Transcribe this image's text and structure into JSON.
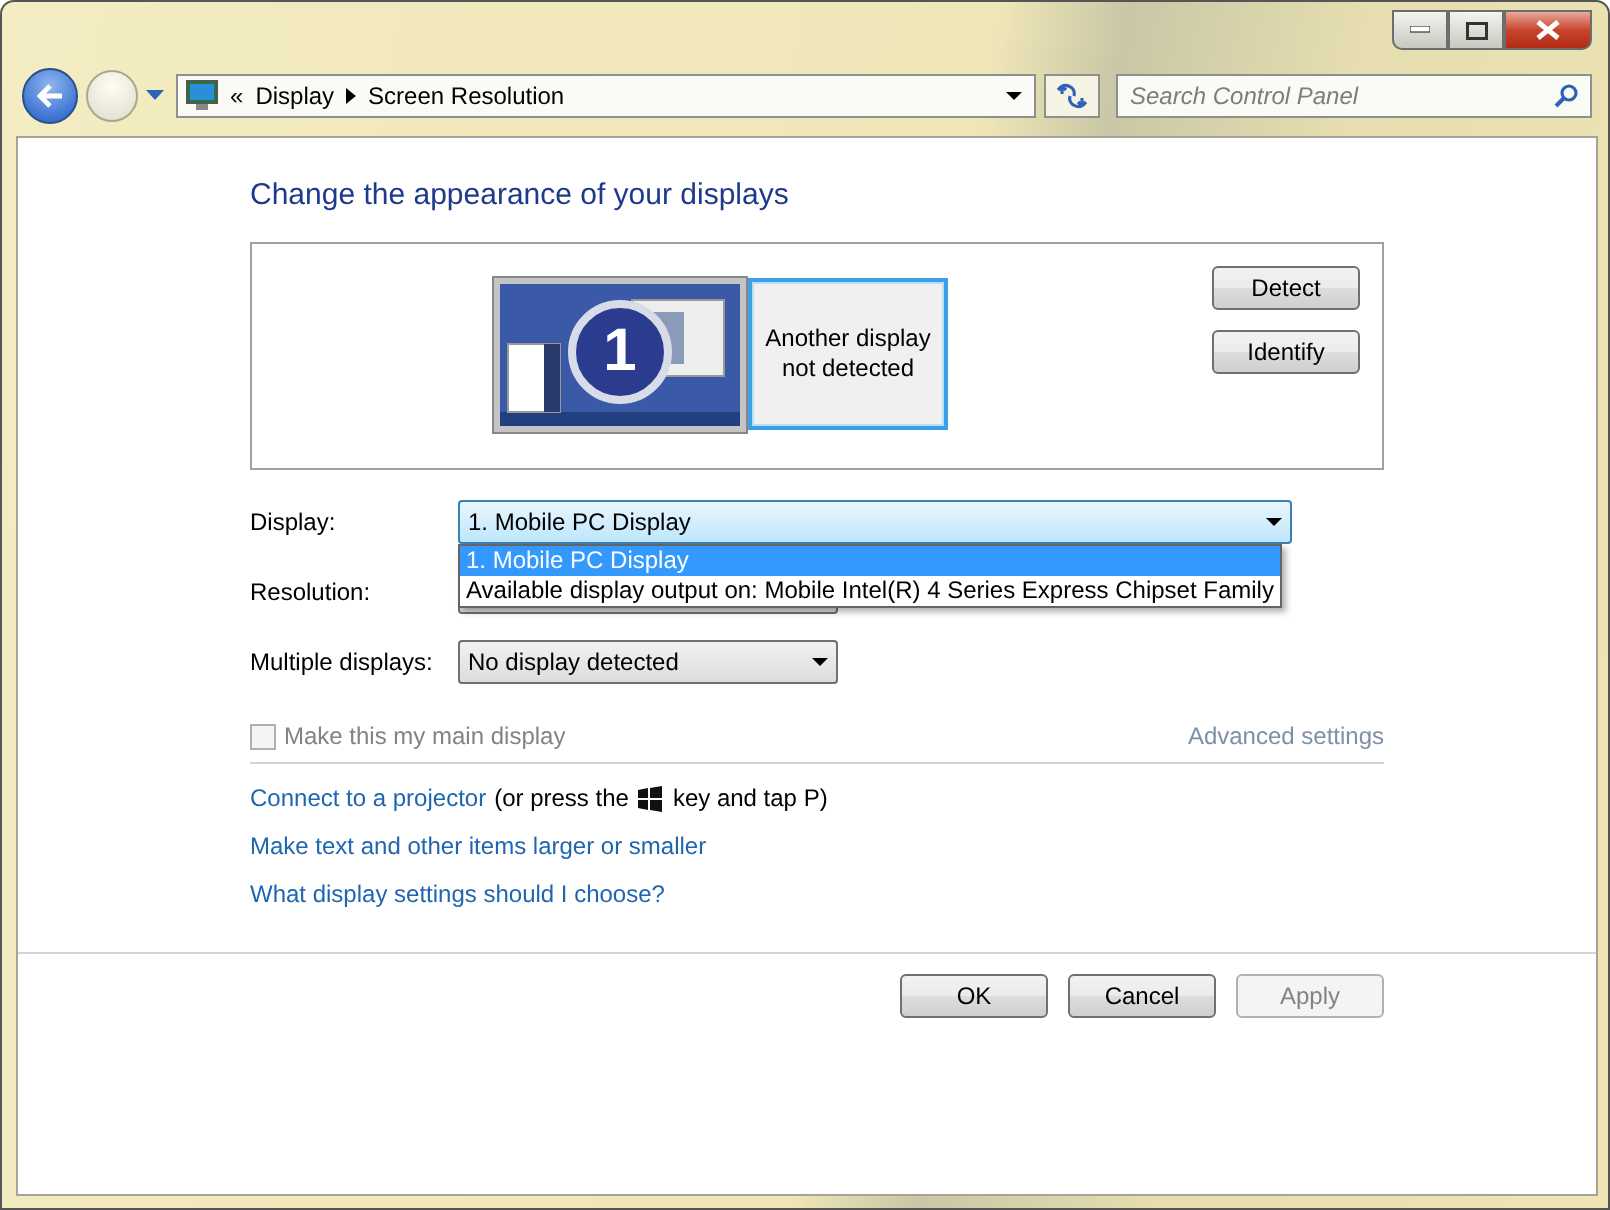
{
  "address_bar": {
    "crumbs": [
      "Display",
      "Screen Resolution"
    ],
    "overflow": "«"
  },
  "search": {
    "placeholder": "Search Control Panel"
  },
  "heading": "Change the appearance of your displays",
  "displays": [
    {
      "kind": "monitor",
      "number": "1"
    },
    {
      "kind": "empty",
      "label": "Another display not detected"
    }
  ],
  "side_buttons": [
    "Detect",
    "Identify"
  ],
  "fields": [
    {
      "label": "Display:",
      "value": "1. Mobile PC Display",
      "expanded": true,
      "options": [
        {
          "label": "1. Mobile PC Display",
          "selected": true
        },
        {
          "label": "Available display output on: Mobile Intel(R) 4 Series Express Chipset Family",
          "selected": false
        }
      ]
    },
    {
      "label": "Resolution:"
    },
    {
      "label": "Multiple displays:",
      "value": "No display detected",
      "expanded": false
    }
  ],
  "main_display": {
    "label": "Make this my main display",
    "checked": false,
    "disabled": true
  },
  "advanced_link": "Advanced settings",
  "projector": {
    "link": "Connect to a projector",
    "before": "(or press the",
    "after": "key and tap P)"
  },
  "links": [
    "Make text and other items larger or smaller",
    "What display settings should I choose?"
  ],
  "buttons": [
    {
      "label": "OK",
      "disabled": false
    },
    {
      "label": "Cancel",
      "disabled": false
    },
    {
      "label": "Apply",
      "disabled": true
    }
  ]
}
